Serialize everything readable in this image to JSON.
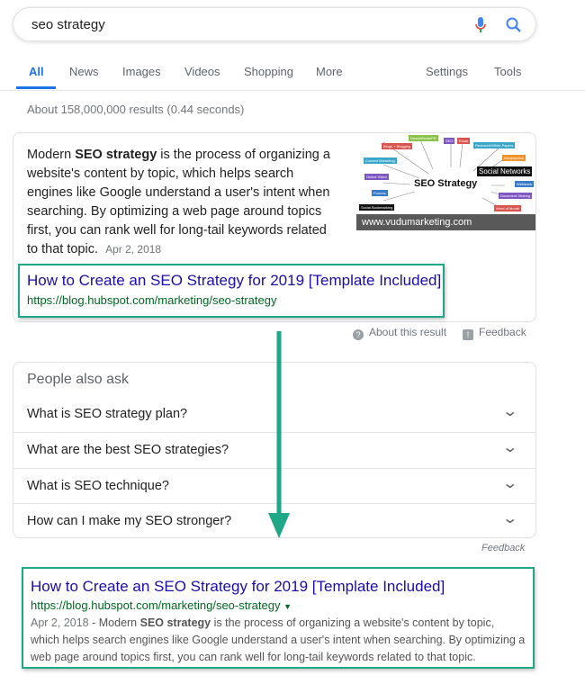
{
  "search": {
    "query": "seo strategy",
    "mic_icon": "microphone-icon",
    "search_icon": "magnifier-icon"
  },
  "tabs": {
    "all": "All",
    "news": "News",
    "images": "Images",
    "videos": "Videos",
    "shopping": "Shopping",
    "more": "More",
    "settings": "Settings",
    "tools": "Tools"
  },
  "result_count": "About 158,000,000 results (0.44 seconds)",
  "snippet": {
    "text_pre": "Modern ",
    "text_bold": "SEO strategy",
    "text_post": " is the process of organizing a website's content by topic, which helps search engines like Google understand a user's intent when searching. By optimizing a web page around topics first, you can rank well for long-tail keywords related to that topic.",
    "date": "Apr 2, 2018",
    "image": {
      "center": "SEO Strategy",
      "caption": "www.vudumarketing.com",
      "labels": [
        "News/Media/PR",
        "SEO",
        "Email",
        "Blogs + Blogging",
        "Research/White Papers",
        "Infographics",
        "Content Marketing",
        "Social Networks",
        "Online Video",
        "Webinars",
        "Forums",
        "Document Sharing",
        "Social Bookmarking",
        "Word of Mouth"
      ]
    },
    "title": "How to Create an SEO Strategy for 2019 [Template Included]",
    "url": "https://blog.hubspot.com/marketing/seo-strategy",
    "about": "About this result",
    "feedback": "Feedback"
  },
  "people_also_ask": {
    "heading": "People also ask",
    "questions": [
      "What is SEO strategy plan?",
      "What are the best SEO strategies?",
      "What is SEO technique?",
      "How can I make my SEO stronger?"
    ],
    "feedback": "Feedback"
  },
  "result": {
    "title": "How to Create an SEO Strategy for 2019 [Template Included]",
    "url": "https://blog.hubspot.com/marketing/seo-strategy",
    "date": "Apr 2, 2018",
    "sep": " - ",
    "text_pre": "Modern ",
    "text_bold": "SEO strategy",
    "text_post": " is the process of organizing a website's content by topic, which helps search engines like Google understand a user's intent when searching. By optimizing a web page around topics first, you can rank well for long-tail keywords related to that topic."
  },
  "colors": {
    "highlight": "#1fa887",
    "link": "#1a0dab",
    "url": "#006621",
    "accent": "#1a73e8"
  }
}
